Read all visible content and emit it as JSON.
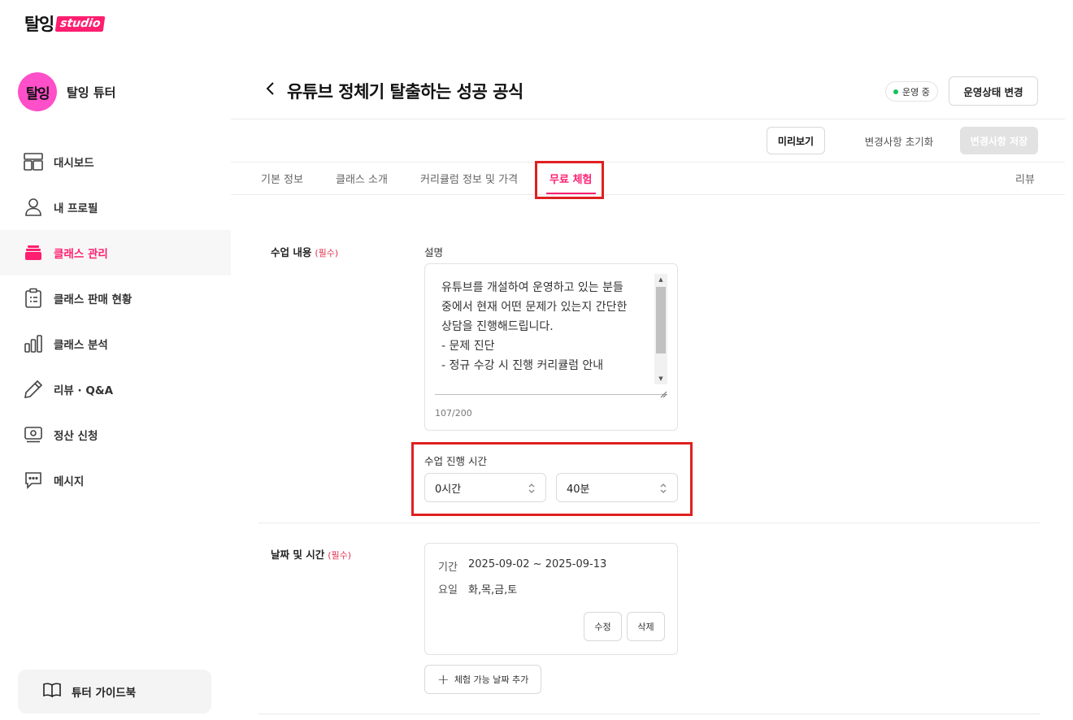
{
  "brand": {
    "main": "탈잉",
    "sub": "studio"
  },
  "profile": {
    "avatar_text": "탈잉",
    "name": "탈잉 튜터"
  },
  "sidebar": {
    "items": [
      {
        "label": "대시보드",
        "icon": "dashboard-icon"
      },
      {
        "label": "내 프로필",
        "icon": "user-icon"
      },
      {
        "label": "클래스 관리",
        "icon": "class-stack-icon",
        "active": true
      },
      {
        "label": "클래스 판매 현황",
        "icon": "clipboard-icon"
      },
      {
        "label": "클래스 분석",
        "icon": "bar-chart-icon"
      },
      {
        "label": "리뷰 · Q&A",
        "icon": "pencil-icon"
      },
      {
        "label": "정산 신청",
        "icon": "cash-icon"
      },
      {
        "label": "메시지",
        "icon": "chat-icon"
      }
    ],
    "guide_label": "튜터 가이드북"
  },
  "header": {
    "title": "유튜브 정체기 탈출하는 성공 공식",
    "status": "운영 중",
    "change_status_label": "운영상태 변경",
    "preview_label": "미리보기",
    "reset_label": "변경사항 초기화",
    "save_label": "변경사항 저장"
  },
  "tabs": [
    {
      "label": "기본 정보"
    },
    {
      "label": "클래스 소개"
    },
    {
      "label": "커리큘럼 정보 및 가격"
    },
    {
      "label": "무료 체험",
      "active": true
    },
    {
      "label": "리뷰"
    }
  ],
  "lesson": {
    "section_label": "수업 내용",
    "required": "(필수)",
    "description_label": "설명",
    "description": "유튜브를 개설하여 운영하고 있는 분들\n중에서 현재 어떤 문제가 있는지 간단한\n상담을 진행해드립니다.\n- 문제 진단\n- 정규 수강 시 진행 커리큘럼 안내",
    "char_count": "107/200",
    "duration_label": "수업 진행 시간",
    "hours_value": "0시간",
    "minutes_value": "40분"
  },
  "schedule": {
    "section_label": "날짜 및 시간",
    "required": "(필수)",
    "period_key": "기간",
    "period_value": "2025-09-02 ~ 2025-09-13",
    "days_key": "요일",
    "days_value": "화,목,금,토",
    "edit_label": "수정",
    "delete_label": "삭제",
    "add_date_label": "체험 가능 날짜 추가"
  },
  "colors": {
    "accent": "#ff1e6f",
    "highlight": "#e02020",
    "status_green": "#16c15e",
    "avatar": "#ff4fc9"
  }
}
